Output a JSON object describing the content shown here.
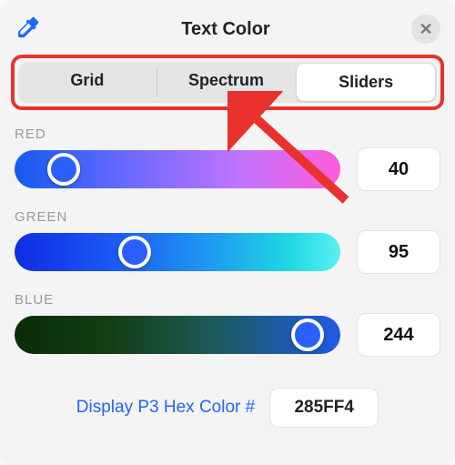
{
  "header": {
    "title": "Text Color"
  },
  "segmented": {
    "items": [
      "Grid",
      "Spectrum",
      "Sliders"
    ],
    "active": 2
  },
  "channels": {
    "red": {
      "label": "RED",
      "value": "40",
      "pct": 15
    },
    "green": {
      "label": "GREEN",
      "value": "95",
      "pct": 37
    },
    "blue": {
      "label": "BLUE",
      "value": "244",
      "pct": 90
    }
  },
  "hex": {
    "label": "Display P3 Hex Color #",
    "value": "285FF4"
  }
}
